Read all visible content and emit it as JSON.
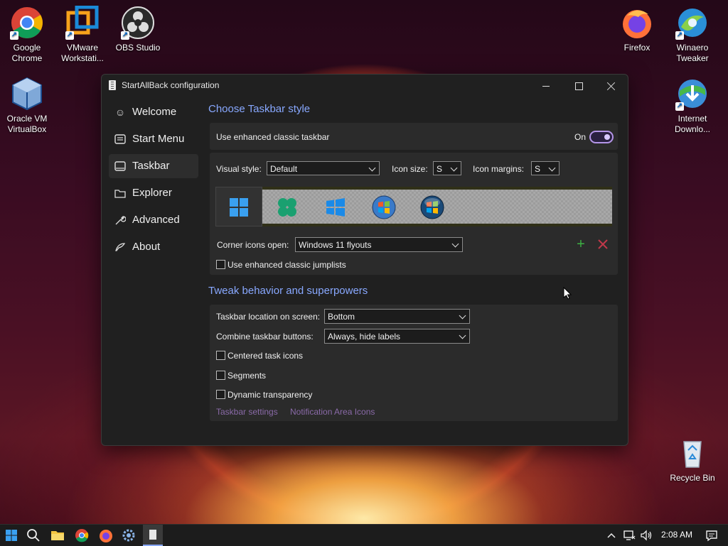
{
  "desktop": {
    "icons": [
      {
        "label": "Google\nChrome"
      },
      {
        "label": "VMware\nWorkstati..."
      },
      {
        "label": "OBS Studio"
      },
      {
        "label": "Firefox"
      },
      {
        "label": "Winaero\nTweaker"
      },
      {
        "label": "Oracle VM\nVirtualBox"
      },
      {
        "label": "Internet\nDownlo..."
      },
      {
        "label": "Recycle Bin"
      }
    ]
  },
  "window": {
    "title": "StartAllBack configuration",
    "nav": [
      {
        "label": "Welcome",
        "icon": "smile-icon"
      },
      {
        "label": "Start Menu",
        "icon": "start-menu-icon"
      },
      {
        "label": "Taskbar",
        "icon": "taskbar-icon",
        "active": true
      },
      {
        "label": "Explorer",
        "icon": "folder-icon"
      },
      {
        "label": "Advanced",
        "icon": "wrench-icon"
      },
      {
        "label": "About",
        "icon": "about-icon"
      }
    ],
    "style_section": {
      "title": "Choose Taskbar style",
      "enhanced_label": "Use enhanced classic taskbar",
      "enhanced_state": "On",
      "visual_style_label": "Visual style:",
      "visual_style_value": "Default",
      "icon_size_label": "Icon size:",
      "icon_size_value": "S",
      "icon_margins_label": "Icon margins:",
      "icon_margins_value": "S",
      "corner_label": "Corner icons open:",
      "corner_value": "Windows 11 flyouts",
      "jumplists_label": "Use enhanced classic jumplists"
    },
    "tweak_section": {
      "title": "Tweak behavior and superpowers",
      "location_label": "Taskbar location on screen:",
      "location_value": "Bottom",
      "combine_label": "Combine taskbar buttons:",
      "combine_value": "Always, hide labels",
      "centered_label": "Centered task icons",
      "segments_label": "Segments",
      "dynamic_label": "Dynamic transparency",
      "link_settings": "Taskbar settings",
      "link_notification": "Notification Area Icons"
    }
  },
  "taskbar": {
    "clock": "2:08 AM"
  },
  "colors": {
    "accent_link": "#88a8ff",
    "toggle": "#b495e8",
    "plus": "#3cb043",
    "x": "#c0384a"
  }
}
